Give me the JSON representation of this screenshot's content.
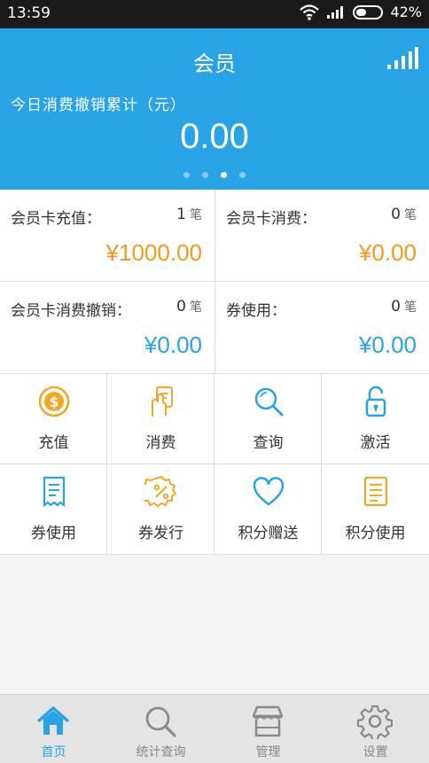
{
  "status_bar": {
    "time": "13:59",
    "battery": "42%",
    "battery_level": 0.42
  },
  "header": {
    "title": "会员",
    "subtitle": "今日消费撤销累计（元）",
    "amount": "0.00",
    "page_count": 4,
    "active_page": 2
  },
  "stats": [
    {
      "label": "会员卡充值：",
      "count": "1",
      "unit": "笔",
      "value": "¥1000.00",
      "color": "#f39a1e"
    },
    {
      "label": "会员卡消费：",
      "count": "0",
      "unit": "笔",
      "value": "¥0.00",
      "color": "#f39a1e"
    },
    {
      "label": "会员卡消费撤销：",
      "count": "0",
      "unit": "笔",
      "value": "¥0.00",
      "color": "#27a3e6"
    },
    {
      "label": "券使用：",
      "count": "0",
      "unit": "笔",
      "value": "¥0.00",
      "color": "#27a3e6"
    }
  ],
  "actions": [
    {
      "label": "充值",
      "icon": "coin-icon"
    },
    {
      "label": "消费",
      "icon": "hand-card-icon"
    },
    {
      "label": "查询",
      "icon": "search-icon"
    },
    {
      "label": "激活",
      "icon": "unlock-icon"
    },
    {
      "label": "券使用",
      "icon": "receipt-icon"
    },
    {
      "label": "券发行",
      "icon": "percent-badge-icon"
    },
    {
      "label": "积分赠送",
      "icon": "heart-icon"
    },
    {
      "label": "积分使用",
      "icon": "list-doc-icon"
    }
  ],
  "tabs": [
    {
      "label": "首页",
      "icon": "home-icon",
      "active": true
    },
    {
      "label": "统计查询",
      "icon": "search-icon",
      "active": false
    },
    {
      "label": "管理",
      "icon": "store-icon",
      "active": false
    },
    {
      "label": "设置",
      "icon": "gear-icon",
      "active": false
    }
  ],
  "colors": {
    "primary": "#27a3e6",
    "orange": "#f39a1e",
    "icon_orange": "#f5a623",
    "icon_blue": "#27a3e6"
  }
}
